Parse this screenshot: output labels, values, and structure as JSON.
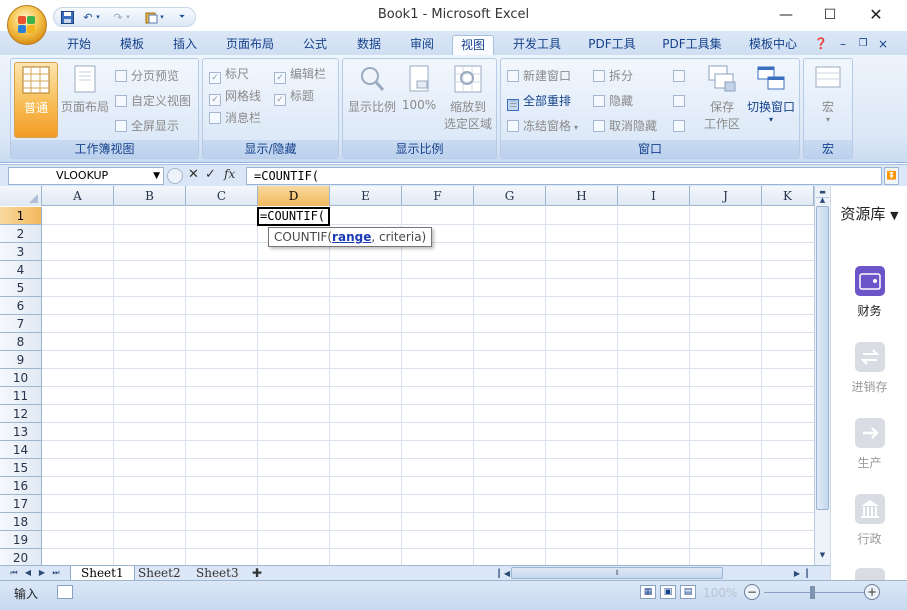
{
  "window": {
    "title": "Book1 - Microsoft Excel",
    "orb_label": "Office Button"
  },
  "qat": {
    "icons": [
      "save-icon",
      "undo-icon",
      "redo-icon",
      "paste-icon",
      "customize-icon"
    ]
  },
  "tabs": [
    {
      "label": "开始",
      "active": false
    },
    {
      "label": "模板",
      "active": false
    },
    {
      "label": "插入",
      "active": false
    },
    {
      "label": "页面布局",
      "active": false
    },
    {
      "label": "公式",
      "active": false
    },
    {
      "label": "数据",
      "active": false
    },
    {
      "label": "审阅",
      "active": false
    },
    {
      "label": "视图",
      "active": true
    },
    {
      "label": "开发工具",
      "active": false
    },
    {
      "label": "PDF工具",
      "active": false
    },
    {
      "label": "PDF工具集",
      "active": false
    },
    {
      "label": "模板中心",
      "active": false
    }
  ],
  "ribbon": {
    "workbook_views": {
      "title": "工作簿视图",
      "normal": "普通",
      "page_layout": "页面布局",
      "page_break": "分页预览",
      "custom_view": "自定义视图",
      "full_screen": "全屏显示"
    },
    "show_hide": {
      "title": "显示/隐藏",
      "ruler": "标尺",
      "formula_bar": "编辑栏",
      "gridlines": "网格线",
      "headings": "标题",
      "message_bar": "消息栏"
    },
    "zoom": {
      "title": "显示比例",
      "zoom": "显示比例",
      "hundred": "100%",
      "zoom_to_selection_1": "缩放到",
      "zoom_to_selection_2": "选定区域"
    },
    "window": {
      "title": "窗口",
      "new_window": "新建窗口",
      "arrange_all": "全部重排",
      "freeze_panes": "冻结窗格",
      "split": "拆分",
      "hide": "隐藏",
      "unhide": "取消隐藏",
      "save_workspace_1": "保存",
      "save_workspace_2": "工作区",
      "switch_windows": "切换窗口"
    },
    "macros": {
      "title": "宏",
      "macros": "宏"
    }
  },
  "formula_bar": {
    "name_box": "VLOOKUP",
    "fx": "fx",
    "formula": "=COUNTIF("
  },
  "sheet": {
    "columns": [
      "A",
      "B",
      "C",
      "D",
      "E",
      "F",
      "G",
      "H",
      "I",
      "J",
      "K"
    ],
    "selected_column": "D",
    "rows": [
      "1",
      "2",
      "3",
      "4",
      "5",
      "6",
      "7",
      "8",
      "9",
      "10",
      "11",
      "12",
      "13",
      "14",
      "15",
      "16",
      "17",
      "18",
      "19",
      "20"
    ],
    "selected_row": "1",
    "active_cell_text": "=COUNTIF(",
    "tooltip": {
      "prefix": "COUNTIF(",
      "arg_bold": "range",
      "suffix": ", criteria)"
    }
  },
  "sheet_tabs": [
    "Sheet1",
    "Sheet2",
    "Sheet3"
  ],
  "side_panel": {
    "title": "资源库",
    "items": [
      {
        "label": "财务",
        "active": true
      },
      {
        "label": "进销存",
        "active": false
      },
      {
        "label": "生产",
        "active": false
      },
      {
        "label": "行政",
        "active": false
      }
    ]
  },
  "status": {
    "mode": "输入",
    "zoom": "100%"
  },
  "colors": {
    "accent": "#15428b",
    "ribbon_bg": "#dbe7f6",
    "selected_header": "#f2b95d",
    "side_active": "#6b55c8"
  }
}
